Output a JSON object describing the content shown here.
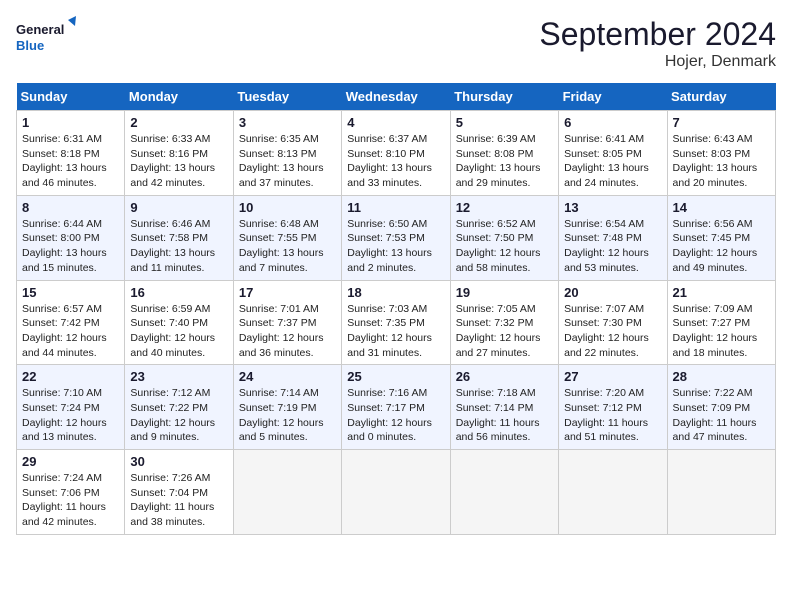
{
  "header": {
    "logo_general": "General",
    "logo_blue": "Blue",
    "month_title": "September 2024",
    "location": "Hojer, Denmark"
  },
  "days_of_week": [
    "Sunday",
    "Monday",
    "Tuesday",
    "Wednesday",
    "Thursday",
    "Friday",
    "Saturday"
  ],
  "weeks": [
    [
      {
        "day": 1,
        "sunrise": "6:31 AM",
        "sunset": "8:18 PM",
        "daylight": "13 hours and 46 minutes."
      },
      {
        "day": 2,
        "sunrise": "6:33 AM",
        "sunset": "8:16 PM",
        "daylight": "13 hours and 42 minutes."
      },
      {
        "day": 3,
        "sunrise": "6:35 AM",
        "sunset": "8:13 PM",
        "daylight": "13 hours and 37 minutes."
      },
      {
        "day": 4,
        "sunrise": "6:37 AM",
        "sunset": "8:10 PM",
        "daylight": "13 hours and 33 minutes."
      },
      {
        "day": 5,
        "sunrise": "6:39 AM",
        "sunset": "8:08 PM",
        "daylight": "13 hours and 29 minutes."
      },
      {
        "day": 6,
        "sunrise": "6:41 AM",
        "sunset": "8:05 PM",
        "daylight": "13 hours and 24 minutes."
      },
      {
        "day": 7,
        "sunrise": "6:43 AM",
        "sunset": "8:03 PM",
        "daylight": "13 hours and 20 minutes."
      }
    ],
    [
      {
        "day": 8,
        "sunrise": "6:44 AM",
        "sunset": "8:00 PM",
        "daylight": "13 hours and 15 minutes."
      },
      {
        "day": 9,
        "sunrise": "6:46 AM",
        "sunset": "7:58 PM",
        "daylight": "13 hours and 11 minutes."
      },
      {
        "day": 10,
        "sunrise": "6:48 AM",
        "sunset": "7:55 PM",
        "daylight": "13 hours and 7 minutes."
      },
      {
        "day": 11,
        "sunrise": "6:50 AM",
        "sunset": "7:53 PM",
        "daylight": "13 hours and 2 minutes."
      },
      {
        "day": 12,
        "sunrise": "6:52 AM",
        "sunset": "7:50 PM",
        "daylight": "12 hours and 58 minutes."
      },
      {
        "day": 13,
        "sunrise": "6:54 AM",
        "sunset": "7:48 PM",
        "daylight": "12 hours and 53 minutes."
      },
      {
        "day": 14,
        "sunrise": "6:56 AM",
        "sunset": "7:45 PM",
        "daylight": "12 hours and 49 minutes."
      }
    ],
    [
      {
        "day": 15,
        "sunrise": "6:57 AM",
        "sunset": "7:42 PM",
        "daylight": "12 hours and 44 minutes."
      },
      {
        "day": 16,
        "sunrise": "6:59 AM",
        "sunset": "7:40 PM",
        "daylight": "12 hours and 40 minutes."
      },
      {
        "day": 17,
        "sunrise": "7:01 AM",
        "sunset": "7:37 PM",
        "daylight": "12 hours and 36 minutes."
      },
      {
        "day": 18,
        "sunrise": "7:03 AM",
        "sunset": "7:35 PM",
        "daylight": "12 hours and 31 minutes."
      },
      {
        "day": 19,
        "sunrise": "7:05 AM",
        "sunset": "7:32 PM",
        "daylight": "12 hours and 27 minutes."
      },
      {
        "day": 20,
        "sunrise": "7:07 AM",
        "sunset": "7:30 PM",
        "daylight": "12 hours and 22 minutes."
      },
      {
        "day": 21,
        "sunrise": "7:09 AM",
        "sunset": "7:27 PM",
        "daylight": "12 hours and 18 minutes."
      }
    ],
    [
      {
        "day": 22,
        "sunrise": "7:10 AM",
        "sunset": "7:24 PM",
        "daylight": "12 hours and 13 minutes."
      },
      {
        "day": 23,
        "sunrise": "7:12 AM",
        "sunset": "7:22 PM",
        "daylight": "12 hours and 9 minutes."
      },
      {
        "day": 24,
        "sunrise": "7:14 AM",
        "sunset": "7:19 PM",
        "daylight": "12 hours and 5 minutes."
      },
      {
        "day": 25,
        "sunrise": "7:16 AM",
        "sunset": "7:17 PM",
        "daylight": "12 hours and 0 minutes."
      },
      {
        "day": 26,
        "sunrise": "7:18 AM",
        "sunset": "7:14 PM",
        "daylight": "11 hours and 56 minutes."
      },
      {
        "day": 27,
        "sunrise": "7:20 AM",
        "sunset": "7:12 PM",
        "daylight": "11 hours and 51 minutes."
      },
      {
        "day": 28,
        "sunrise": "7:22 AM",
        "sunset": "7:09 PM",
        "daylight": "11 hours and 47 minutes."
      }
    ],
    [
      {
        "day": 29,
        "sunrise": "7:24 AM",
        "sunset": "7:06 PM",
        "daylight": "11 hours and 42 minutes."
      },
      {
        "day": 30,
        "sunrise": "7:26 AM",
        "sunset": "7:04 PM",
        "daylight": "11 hours and 38 minutes."
      },
      null,
      null,
      null,
      null,
      null
    ]
  ]
}
